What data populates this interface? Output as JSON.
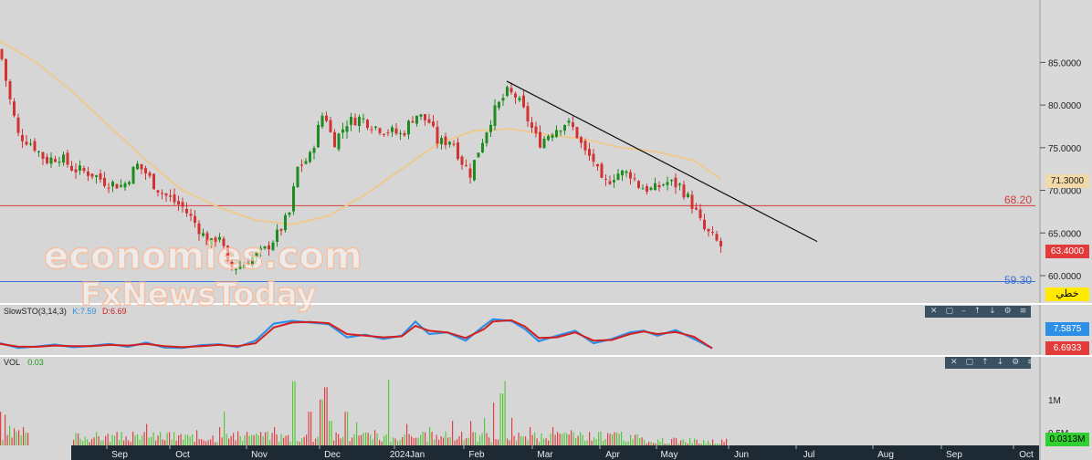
{
  "chart_data": {
    "type": "candlestick",
    "x_ticks": [
      "Sep",
      "Oct",
      "Nov",
      "Dec",
      "2024Jan",
      "Feb",
      "Mar",
      "Apr",
      "May",
      "Jun",
      "Jul",
      "Aug",
      "Sep",
      "Oct"
    ],
    "y_ticks": [
      "85.0000",
      "80.0000",
      "75.0000",
      "70.0000",
      "65.0000",
      "60.0000"
    ],
    "ylim": [
      57,
      92
    ],
    "price_path": [
      [
        0,
        86.5
      ],
      [
        10,
        81
      ],
      [
        20,
        76.5
      ],
      [
        35,
        75.5
      ],
      [
        50,
        73.5
      ],
      [
        65,
        74
      ],
      [
        80,
        72.5
      ],
      [
        100,
        72
      ],
      [
        115,
        71
      ],
      [
        135,
        70.5
      ],
      [
        150,
        73
      ],
      [
        160,
        72
      ],
      [
        170,
        70.5
      ],
      [
        180,
        69.5
      ],
      [
        200,
        68
      ],
      [
        215,
        66
      ],
      [
        230,
        63.5
      ],
      [
        240,
        65
      ],
      [
        250,
        61
      ],
      [
        262,
        61
      ],
      [
        275,
        62
      ],
      [
        290,
        63
      ],
      [
        305,
        65
      ],
      [
        318,
        67.5
      ],
      [
        325,
        72.5
      ],
      [
        340,
        74
      ],
      [
        345,
        76
      ],
      [
        355,
        79.5
      ],
      [
        365,
        75.5
      ],
      [
        380,
        78
      ],
      [
        395,
        78.5
      ],
      [
        410,
        77.5
      ],
      [
        425,
        77
      ],
      [
        440,
        76.5
      ],
      [
        455,
        79
      ],
      [
        470,
        78
      ],
      [
        480,
        75.5
      ],
      [
        495,
        76
      ],
      [
        505,
        73.5
      ],
      [
        515,
        72
      ],
      [
        525,
        75
      ],
      [
        540,
        79
      ],
      [
        555,
        81.5
      ],
      [
        565,
        81
      ],
      [
        575,
        79
      ],
      [
        590,
        75.5
      ],
      [
        605,
        77
      ],
      [
        620,
        78
      ],
      [
        630,
        77
      ],
      [
        640,
        74.5
      ],
      [
        650,
        73.5
      ],
      [
        660,
        70.5
      ],
      [
        675,
        72
      ],
      [
        690,
        72
      ],
      [
        700,
        70.5
      ],
      [
        715,
        70
      ],
      [
        730,
        71
      ],
      [
        745,
        70.5
      ],
      [
        760,
        68
      ],
      [
        770,
        65.5
      ],
      [
        780,
        64.5
      ],
      [
        790,
        63.4
      ]
    ],
    "ma_path": [
      [
        0,
        87.5
      ],
      [
        40,
        85
      ],
      [
        80,
        81.5
      ],
      [
        120,
        77.5
      ],
      [
        160,
        73.5
      ],
      [
        200,
        70
      ],
      [
        240,
        68
      ],
      [
        280,
        66.5
      ],
      [
        320,
        66
      ],
      [
        360,
        67
      ],
      [
        400,
        69.5
      ],
      [
        440,
        72.5
      ],
      [
        480,
        75.5
      ],
      [
        520,
        77
      ],
      [
        560,
        77.2
      ],
      [
        600,
        76.5
      ],
      [
        640,
        76
      ],
      [
        680,
        75
      ],
      [
        720,
        74.5
      ],
      [
        760,
        73.5
      ],
      [
        790,
        71.3
      ]
    ],
    "trendline": {
      "from": [
        555,
        82.8
      ],
      "to": [
        895,
        64
      ]
    },
    "levels": [
      {
        "value": 68.2,
        "label": "68.20",
        "color": "#d23c3c"
      },
      {
        "value": 59.3,
        "label": "59.30",
        "color": "#3a6fd6"
      }
    ],
    "last_price": "63.4000",
    "ma_value": "71.3000",
    "last_price_color": "#e33a3a",
    "indicator": {
      "name": "SlowSTO(3,14,3)",
      "k_label": "K:7.59",
      "d_label": "D:6.69",
      "k_value": "7.5875",
      "d_value": "6.6933",
      "k_path": [
        [
          0,
          22
        ],
        [
          20,
          8
        ],
        [
          40,
          12
        ],
        [
          60,
          18
        ],
        [
          80,
          10
        ],
        [
          100,
          14
        ],
        [
          120,
          20
        ],
        [
          140,
          11
        ],
        [
          160,
          24
        ],
        [
          180,
          9
        ],
        [
          200,
          8
        ],
        [
          220,
          16
        ],
        [
          240,
          19
        ],
        [
          260,
          10
        ],
        [
          280,
          30
        ],
        [
          300,
          82
        ],
        [
          320,
          90
        ],
        [
          340,
          85
        ],
        [
          360,
          80
        ],
        [
          380,
          40
        ],
        [
          400,
          48
        ],
        [
          420,
          35
        ],
        [
          440,
          45
        ],
        [
          455,
          88
        ],
        [
          470,
          50
        ],
        [
          490,
          55
        ],
        [
          510,
          30
        ],
        [
          530,
          75
        ],
        [
          540,
          95
        ],
        [
          560,
          90
        ],
        [
          575,
          65
        ],
        [
          590,
          28
        ],
        [
          610,
          45
        ],
        [
          630,
          60
        ],
        [
          650,
          22
        ],
        [
          670,
          35
        ],
        [
          690,
          55
        ],
        [
          705,
          60
        ],
        [
          720,
          45
        ],
        [
          740,
          62
        ],
        [
          760,
          35
        ],
        [
          780,
          7
        ]
      ],
      "d_path": [
        [
          0,
          20
        ],
        [
          20,
          12
        ],
        [
          40,
          11
        ],
        [
          60,
          15
        ],
        [
          80,
          13
        ],
        [
          100,
          13
        ],
        [
          120,
          17
        ],
        [
          140,
          15
        ],
        [
          160,
          20
        ],
        [
          180,
          13
        ],
        [
          200,
          10
        ],
        [
          220,
          13
        ],
        [
          240,
          17
        ],
        [
          260,
          13
        ],
        [
          280,
          22
        ],
        [
          300,
          70
        ],
        [
          320,
          85
        ],
        [
          340,
          87
        ],
        [
          360,
          83
        ],
        [
          380,
          50
        ],
        [
          400,
          45
        ],
        [
          420,
          40
        ],
        [
          440,
          43
        ],
        [
          455,
          75
        ],
        [
          470,
          60
        ],
        [
          490,
          55
        ],
        [
          510,
          38
        ],
        [
          530,
          65
        ],
        [
          540,
          88
        ],
        [
          560,
          92
        ],
        [
          575,
          73
        ],
        [
          590,
          38
        ],
        [
          610,
          40
        ],
        [
          630,
          55
        ],
        [
          650,
          30
        ],
        [
          670,
          32
        ],
        [
          690,
          50
        ],
        [
          705,
          58
        ],
        [
          720,
          50
        ],
        [
          740,
          56
        ],
        [
          760,
          42
        ],
        [
          780,
          6.7
        ]
      ]
    },
    "volume": {
      "name": "VOL",
      "value_label": "0.03",
      "ticks": [
        "1M",
        "0.5M"
      ],
      "last": "0.0313M",
      "spikes": [
        [
          0,
          0.55
        ],
        [
          5,
          0.5
        ],
        [
          10,
          0.32
        ],
        [
          15,
          0.28
        ],
        [
          20,
          0.25
        ],
        [
          25,
          0.3
        ],
        [
          150,
          0.18
        ],
        [
          160,
          0.35
        ],
        [
          175,
          0.22
        ],
        [
          215,
          0.25
        ],
        [
          240,
          0.3
        ],
        [
          245,
          0.55
        ],
        [
          270,
          0.22
        ],
        [
          300,
          0.3
        ],
        [
          322,
          1.05
        ],
        [
          338,
          0.55
        ],
        [
          352,
          0.75
        ],
        [
          356,
          0.95
        ],
        [
          362,
          0.4
        ],
        [
          378,
          0.55
        ],
        [
          390,
          0.38
        ],
        [
          410,
          0.25
        ],
        [
          425,
          1.08
        ],
        [
          445,
          0.35
        ],
        [
          470,
          0.3
        ],
        [
          495,
          0.4
        ],
        [
          515,
          0.4
        ],
        [
          530,
          0.45
        ],
        [
          540,
          0.7
        ],
        [
          548,
          0.85
        ],
        [
          552,
          1.05
        ],
        [
          560,
          0.45
        ],
        [
          580,
          0.3
        ],
        [
          605,
          0.3
        ],
        [
          625,
          0.25
        ],
        [
          645,
          0.22
        ],
        [
          670,
          0.18
        ],
        [
          700,
          0.12
        ],
        [
          720,
          0.1
        ],
        [
          740,
          0.12
        ]
      ]
    },
    "colors": {
      "up": "#1e8c1e",
      "down": "#d23232",
      "ma": "#eec98f",
      "trend": "#111111",
      "k": "#2d8fe6",
      "d": "#d22020",
      "vol_up": "#55c83c",
      "vol_down": "#e04040"
    }
  },
  "toolbar_icons": [
    "close-icon",
    "box-icon",
    "minimize-icon",
    "up-arrow-icon",
    "down-arrow-icon",
    "settings-icon",
    "more-icon"
  ],
  "tag": "خطي"
}
